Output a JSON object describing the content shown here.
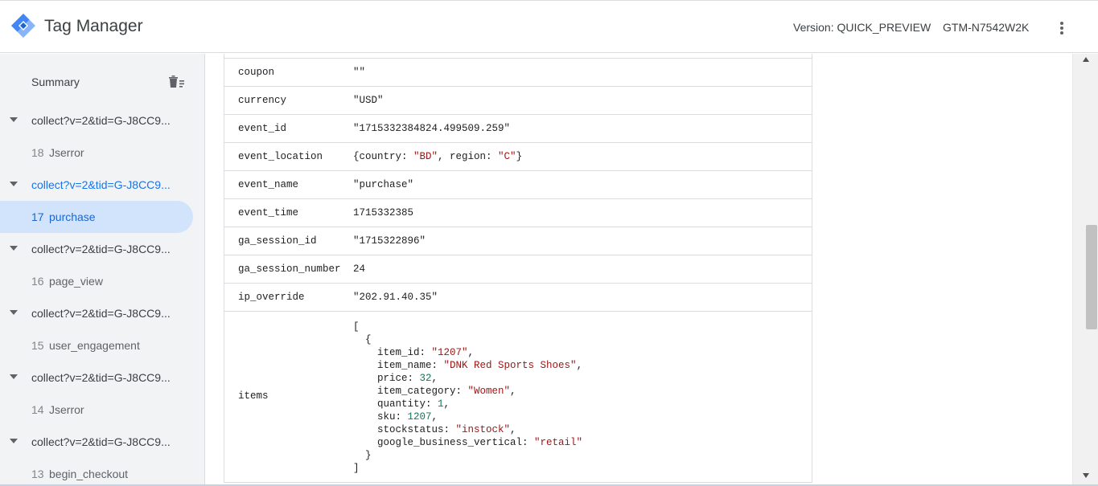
{
  "header": {
    "app_title": "Tag Manager",
    "version": "Version: QUICK_PREVIEW",
    "container_id": "GTM-N7542W2K"
  },
  "sidebar": {
    "summary_label": "Summary",
    "groups": [
      {
        "label": "collect?v=2&tid=G-J8CC9...",
        "event_num": "18",
        "event_name": "Jserror"
      },
      {
        "label": "collect?v=2&tid=G-J8CC9...",
        "event_num": "17",
        "event_name": "purchase"
      },
      {
        "label": "collect?v=2&tid=G-J8CC9...",
        "event_num": "16",
        "event_name": "page_view"
      },
      {
        "label": "collect?v=2&tid=G-J8CC9...",
        "event_num": "15",
        "event_name": "user_engagement"
      },
      {
        "label": "collect?v=2&tid=G-J8CC9...",
        "event_num": "14",
        "event_name": "Jserror"
      },
      {
        "label": "collect?v=2&tid=G-J8CC9...",
        "event_num": "13",
        "event_name": "begin_checkout"
      }
    ]
  },
  "params": {
    "coupon": {
      "key": "coupon",
      "val": "\"\""
    },
    "currency": {
      "key": "currency",
      "val": "\"USD\""
    },
    "event_id": {
      "key": "event_id",
      "val": "\"1715332384824.499509.259\""
    },
    "event_location": {
      "key": "event_location",
      "pre": "{country: ",
      "country": "\"BD\"",
      "mid": ", region: ",
      "region": "\"C\"",
      "post": "}"
    },
    "event_name": {
      "key": "event_name",
      "val": "\"purchase\""
    },
    "event_time": {
      "key": "event_time",
      "val": "1715332385"
    },
    "ga_session_id": {
      "key": "ga_session_id",
      "val": "\"1715322896\""
    },
    "ga_session_number": {
      "key": "ga_session_number",
      "val": "24"
    },
    "ip_override": {
      "key": "ip_override",
      "val": "\"202.91.40.35\""
    },
    "items": {
      "key": "items",
      "open_bracket": "[",
      "open_brace": "{",
      "item_id": "\"1207\"",
      "item_name": "\"DNK Red Sports Shoes\"",
      "price": "32",
      "item_category": "\"Women\"",
      "quantity": "1",
      "sku": "1207",
      "stockstatus": "\"instock\"",
      "google_business_vertical": "\"retail\"",
      "close_brace": "}",
      "close_bracket": "]"
    }
  },
  "colors": {
    "accent": "#1a73e8",
    "selected_bg": "#d2e3fc",
    "string_value": "#a31515",
    "number_value": "#0d7a5f"
  }
}
